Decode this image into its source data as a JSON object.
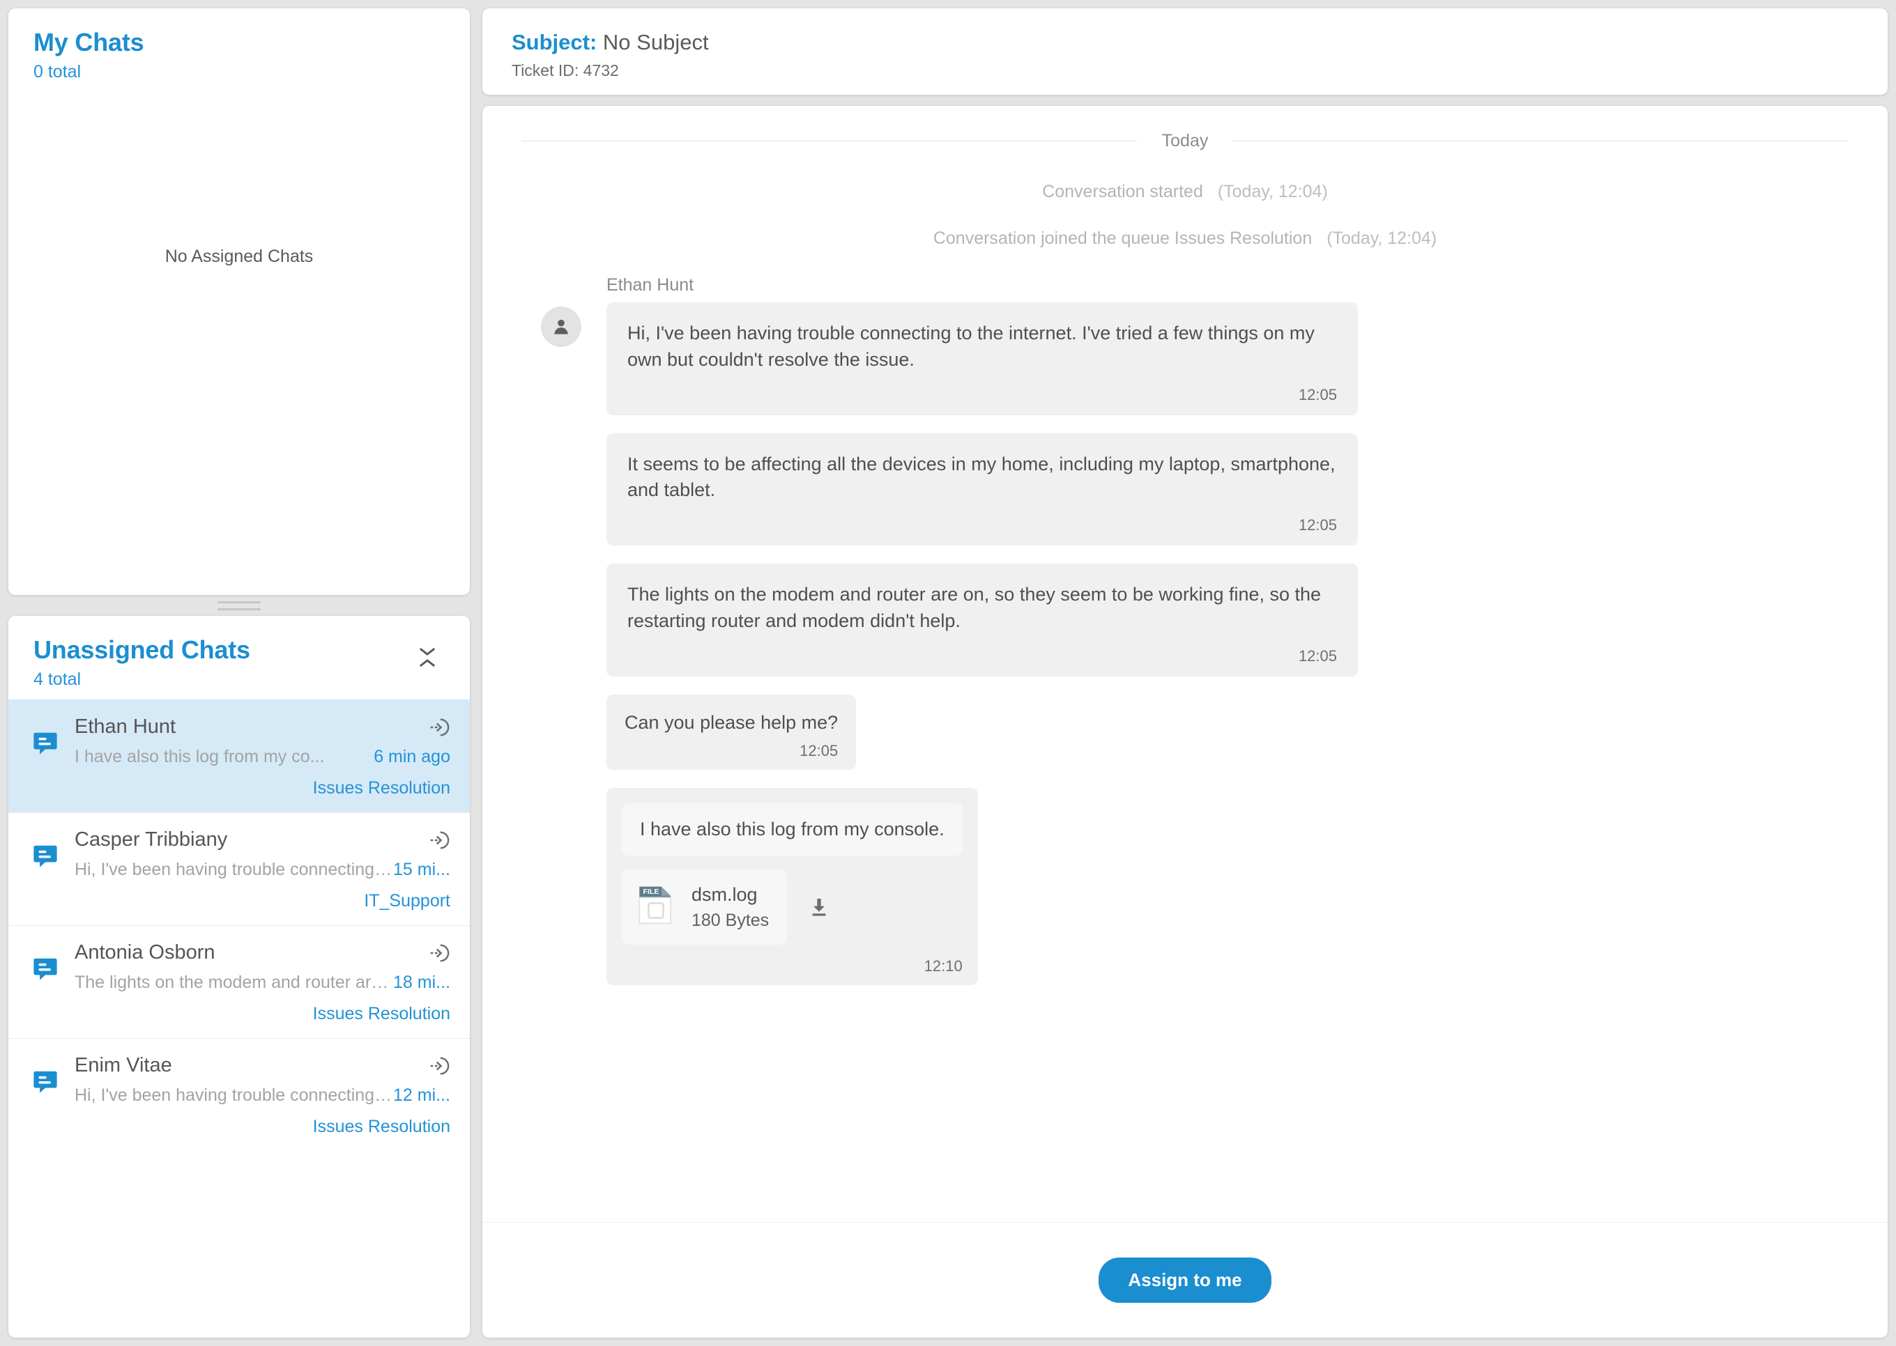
{
  "colors": {
    "accent": "#1b8ed0",
    "link": "#2393d6",
    "active_row": "#d6e9f7",
    "bubble": "#f0f0f0",
    "page_bg": "#e4e4e4",
    "file_badge": "#5f7d8c"
  },
  "my_chats": {
    "title": "My Chats",
    "total": "0 total",
    "empty_text": "No Assigned Chats"
  },
  "unassigned": {
    "title": "Unassigned Chats",
    "total": "4 total",
    "items": [
      {
        "name": "Ethan Hunt",
        "preview": "I have also this log from my co...",
        "time": "6 min ago",
        "queue": "Issues Resolution"
      },
      {
        "name": "Casper Tribbiany",
        "preview": "Hi, I've been having trouble connecting to...",
        "time": "15 mi...",
        "queue": "IT_Support"
      },
      {
        "name": "Antonia Osborn",
        "preview": "The lights on the modem and router are o...",
        "time": "18 mi...",
        "queue": "Issues Resolution"
      },
      {
        "name": "Enim Vitae",
        "preview": "Hi, I've been having trouble connecting to...",
        "time": "12 mi...",
        "queue": "Issues Resolution"
      }
    ]
  },
  "header": {
    "subject_label": "Subject:",
    "subject_value": "No Subject",
    "ticket": "Ticket ID: 4732"
  },
  "conversation": {
    "day_label": "Today",
    "system_events": [
      {
        "text": "Conversation started",
        "stamp": "(Today, 12:04)"
      },
      {
        "text": "Conversation joined the queue Issues Resolution",
        "stamp": "(Today, 12:04)"
      }
    ],
    "sender": "Ethan Hunt",
    "messages": [
      {
        "text": "Hi, I've been having trouble connecting to the internet. I've tried a few things on my own but couldn't resolve the issue.",
        "time": "12:05"
      },
      {
        "text": "It seems to be affecting all the devices in my home, including my laptop, smartphone, and tablet.",
        "time": "12:05"
      },
      {
        "text": "The lights on the modem and router are on, so they seem to be working fine, so the restarting router and modem didn't help.",
        "time": "12:05"
      },
      {
        "text": "Can you please help me?",
        "time": "12:05"
      }
    ],
    "attachment_message": {
      "text": "I have also this log from my console.",
      "file_name": "dsm.log",
      "file_size": "180 Bytes",
      "file_badge": "FILE",
      "time": "12:10"
    }
  },
  "footer": {
    "assign_label": "Assign to me"
  }
}
